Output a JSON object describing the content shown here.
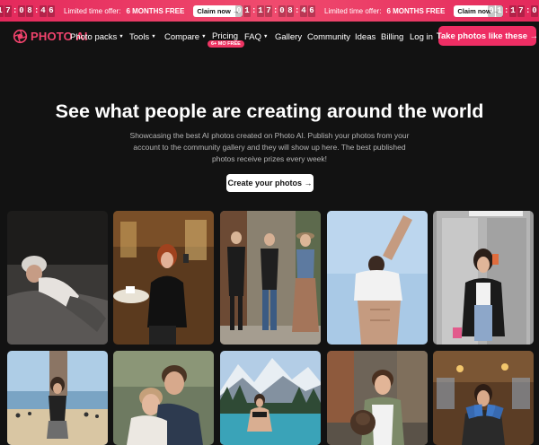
{
  "banner": {
    "promos": [
      {
        "countdown": [
          "1",
          "7",
          ":",
          "0",
          "8",
          ":",
          "4",
          "6"
        ],
        "offer_text": "Limited time offer:",
        "months_text": "6 MONTHS FREE",
        "claim_label": "Claim now →"
      },
      {
        "countdown": [
          "0",
          "1",
          ":",
          "1",
          "7",
          ":",
          "0",
          "8",
          ":",
          "4",
          "6"
        ],
        "offer_text": "Limited time offer:",
        "months_text": "6 MONTHS FREE",
        "claim_label": "Claim now →"
      },
      {
        "countdown": [
          "0",
          "1",
          ":",
          "1",
          "7",
          ":",
          "0"
        ],
        "offer_text": "",
        "months_text": "",
        "claim_label": ""
      }
    ]
  },
  "nav": {
    "logo_text": "PHOTO AI",
    "photo_packs": "Photo packs",
    "tools": "Tools",
    "compare": "Compare",
    "pricing": "Pricing",
    "pricing_badge": "6+ MO FREE",
    "faq": "FAQ",
    "gallery": "Gallery",
    "community": "Community",
    "ideas": "Ideas",
    "billing": "Billing",
    "login": "Log in",
    "cta": "Take photos like these →"
  },
  "hero": {
    "title": "See what people are creating around the world",
    "subtitle": "Showcasing the best AI photos created on Photo AI. Publish your photos from your account to the community gallery and they will show up here. The best published photos receive prizes every week!",
    "button": "Create your photos →"
  },
  "gallery": {
    "photos": [
      {
        "subject": "woman-sleeping-in-bed"
      },
      {
        "subject": "woman-taking-selfie-in-cafe"
      },
      {
        "subject": "three-women-standing-on-street"
      },
      {
        "subject": "man-stretching-in-sky"
      },
      {
        "subject": "woman-mirror-selfie-in-elevator"
      },
      {
        "subject": "woman-standing-on-beach"
      },
      {
        "subject": "couple-posing-outdoors"
      },
      {
        "subject": "woman-at-mountain-lake"
      },
      {
        "subject": "woman-with-dog-in-city"
      },
      {
        "subject": "woman-holding-cards-in-cafe"
      }
    ]
  },
  "colors": {
    "accent": "#ee2e64",
    "background": "#121212",
    "banner": "#e4295c"
  }
}
